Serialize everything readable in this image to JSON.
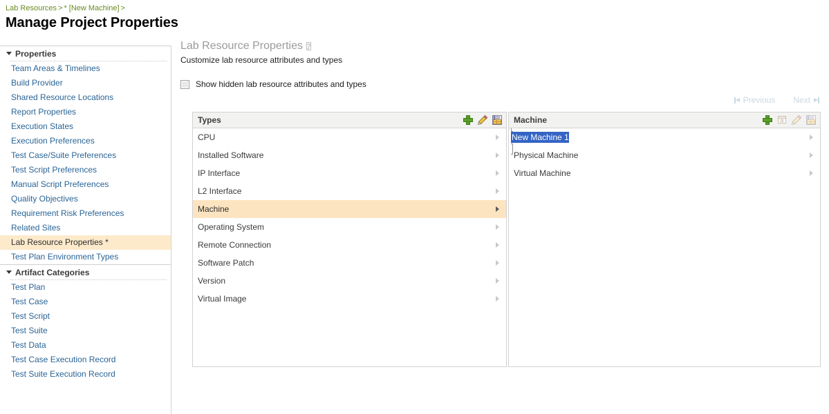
{
  "breadcrumb": {
    "items": [
      "Lab Resources",
      "* [New Machine]"
    ],
    "separator": ">",
    "trailing_separator": ">"
  },
  "page_title": "Manage Project Properties",
  "sidebar": {
    "sections": [
      {
        "title": "Properties",
        "twisty": "chevron-down-icon",
        "items": [
          {
            "label": "Team Areas & Timelines",
            "selected": false
          },
          {
            "label": "Build Provider",
            "selected": false
          },
          {
            "label": "Shared Resource Locations",
            "selected": false
          },
          {
            "label": "Report Properties",
            "selected": false
          },
          {
            "label": "Execution States",
            "selected": false
          },
          {
            "label": "Execution Preferences",
            "selected": false
          },
          {
            "label": "Test Case/Suite Preferences",
            "selected": false
          },
          {
            "label": "Test Script Preferences",
            "selected": false
          },
          {
            "label": "Manual Script Preferences",
            "selected": false
          },
          {
            "label": "Quality Objectives",
            "selected": false
          },
          {
            "label": "Requirement Risk Preferences",
            "selected": false
          },
          {
            "label": "Related Sites",
            "selected": false
          },
          {
            "label": "Lab Resource Properties *",
            "selected": true
          },
          {
            "label": "Test Plan Environment Types",
            "selected": false
          }
        ]
      },
      {
        "title": "Artifact Categories",
        "twisty": "chevron-down-icon",
        "items": [
          {
            "label": "Test Plan",
            "selected": false
          },
          {
            "label": "Test Case",
            "selected": false
          },
          {
            "label": "Test Script",
            "selected": false
          },
          {
            "label": "Test Suite",
            "selected": false
          },
          {
            "label": "Test Data",
            "selected": false
          },
          {
            "label": "Test Case Execution Record",
            "selected": false
          },
          {
            "label": "Test Suite Execution Record",
            "selected": false
          }
        ]
      }
    ]
  },
  "main": {
    "title": "Lab Resource Properties",
    "help_icon_label": "?",
    "subtitle": "Customize lab resource attributes and types",
    "show_hidden_checkbox": {
      "label": "Show hidden lab resource attributes and types",
      "checked": false
    },
    "pagination": {
      "previous_label": "Previous",
      "next_label": "Next",
      "previous_enabled": false,
      "next_enabled": false
    },
    "types_panel": {
      "header": "Types",
      "tools": [
        {
          "name": "add-type-button",
          "icon": "plus-icon",
          "enabled": true
        },
        {
          "name": "edit-type-button",
          "icon": "pencil-icon",
          "enabled": true
        },
        {
          "name": "type-properties-button",
          "icon": "table-properties-icon",
          "enabled": true
        }
      ],
      "rows": [
        {
          "label": "CPU",
          "selected": false
        },
        {
          "label": "Installed Software",
          "selected": false
        },
        {
          "label": "IP Interface",
          "selected": false
        },
        {
          "label": "L2 Interface",
          "selected": false
        },
        {
          "label": "Machine",
          "selected": true
        },
        {
          "label": "Operating System",
          "selected": false
        },
        {
          "label": "Remote Connection",
          "selected": false
        },
        {
          "label": "Software Patch",
          "selected": false
        },
        {
          "label": "Version",
          "selected": false
        },
        {
          "label": "Virtual Image",
          "selected": false
        }
      ]
    },
    "machine_panel": {
      "header": "Machine",
      "tools": [
        {
          "name": "add-machine-button",
          "icon": "plus-icon",
          "enabled": true
        },
        {
          "name": "duplicate-machine-button",
          "icon": "duplicate-icon",
          "enabled": false
        },
        {
          "name": "edit-machine-button",
          "icon": "pencil-icon",
          "enabled": false
        },
        {
          "name": "machine-properties-button",
          "icon": "table-properties-icon",
          "enabled": false
        }
      ],
      "editing_row": {
        "value": "New Machine 1",
        "selected_text": true
      },
      "rows": [
        {
          "label": "Physical Machine",
          "selected": false
        },
        {
          "label": "Virtual Machine",
          "selected": false
        }
      ]
    }
  },
  "colors": {
    "breadcrumb": "#6a8a1f",
    "link": "#2a6496",
    "selection_row": "#fde4c0",
    "sidebar_selection": "#fdeacb",
    "text_selection": "#3464c4",
    "panel_header_bg": "#f2f2f0",
    "panel_border": "#d2d2d2",
    "muted_title": "#9a9a9a",
    "disabled_nav": "#c9d8e4",
    "add_icon_green": "#5aa02c"
  }
}
